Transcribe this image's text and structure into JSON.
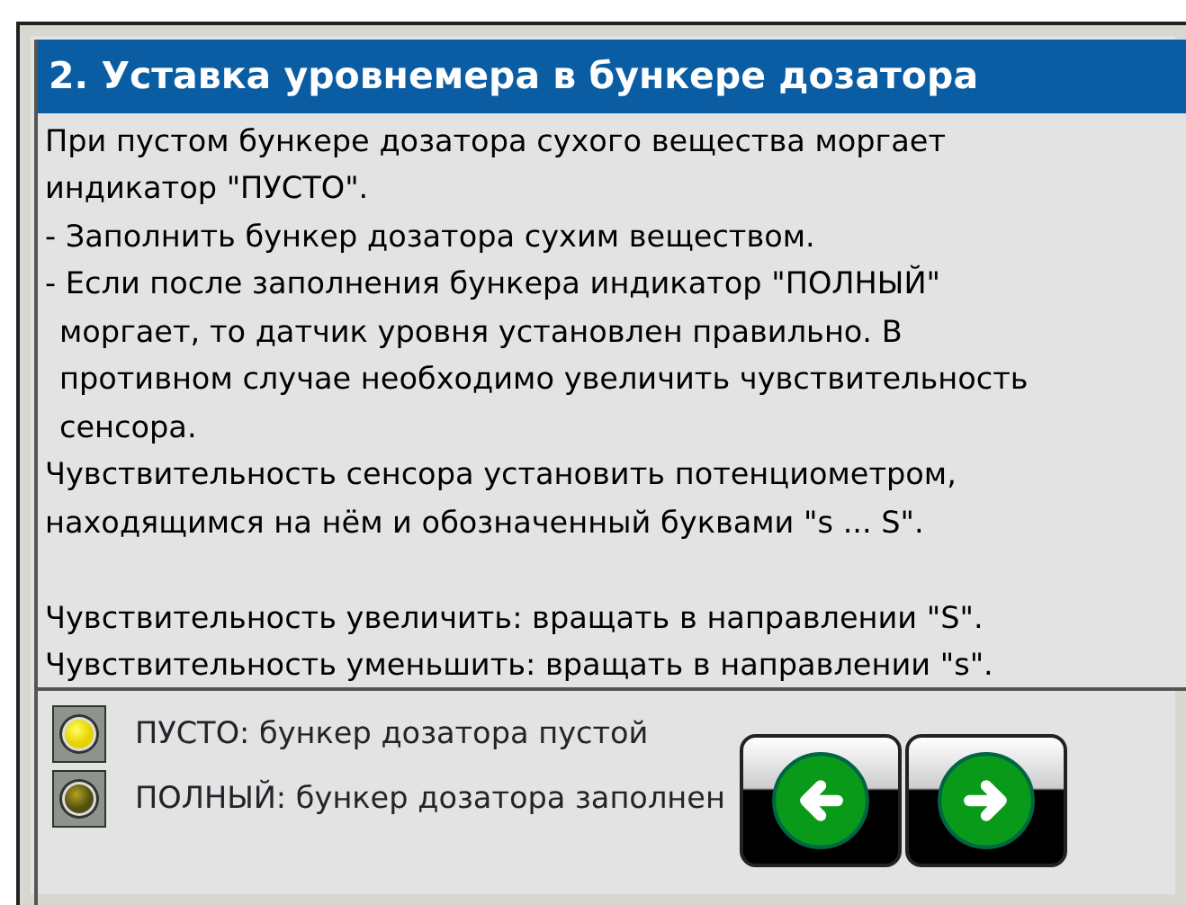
{
  "title": "2. Уставка уровнемера в бункере дозатора",
  "blocks": [
    {
      "lines": [
        {
          "text": "При пустом бункере дозатора сухого вещества моргает",
          "indented": false
        },
        {
          "text": "индикатор \"ПУСТО\".",
          "indented": false
        },
        {
          "text": "- Заполнить бункер дозатора сухим веществом.",
          "indented": false
        },
        {
          "text": "- Если после заполнения бункера индикатор \"ПОЛНЫЙ\"",
          "indented": false
        },
        {
          "text": "моргает, то датчик уровня установлен правильно. В",
          "indented": true
        },
        {
          "text": "противном случае необходимо увеличить чувствительность",
          "indented": true
        },
        {
          "text": "сенсора.",
          "indented": true
        },
        {
          "text": "Чувствительность сенсора установить потенциометром,",
          "indented": false
        },
        {
          "text": "находящимся на нём и обозначенный буквами \"s ... S\".",
          "indented": false
        }
      ]
    },
    {
      "lines": [
        {
          "text": "Чувствительность увеличить: вращать в направлении \"S\".",
          "indented": false
        },
        {
          "text": "Чувствительность уменьшить: вращать в направлении \"s\".",
          "indented": false
        }
      ]
    }
  ],
  "indicators": [
    {
      "label": "ПУСТО: бункер дозатора пустой",
      "lit": true
    },
    {
      "label": "ПОЛНЫЙ: бункер дозатора заполнен",
      "lit": false
    }
  ],
  "nav_buttons": [
    {
      "kind": "back"
    },
    {
      "kind": "forward"
    }
  ]
}
